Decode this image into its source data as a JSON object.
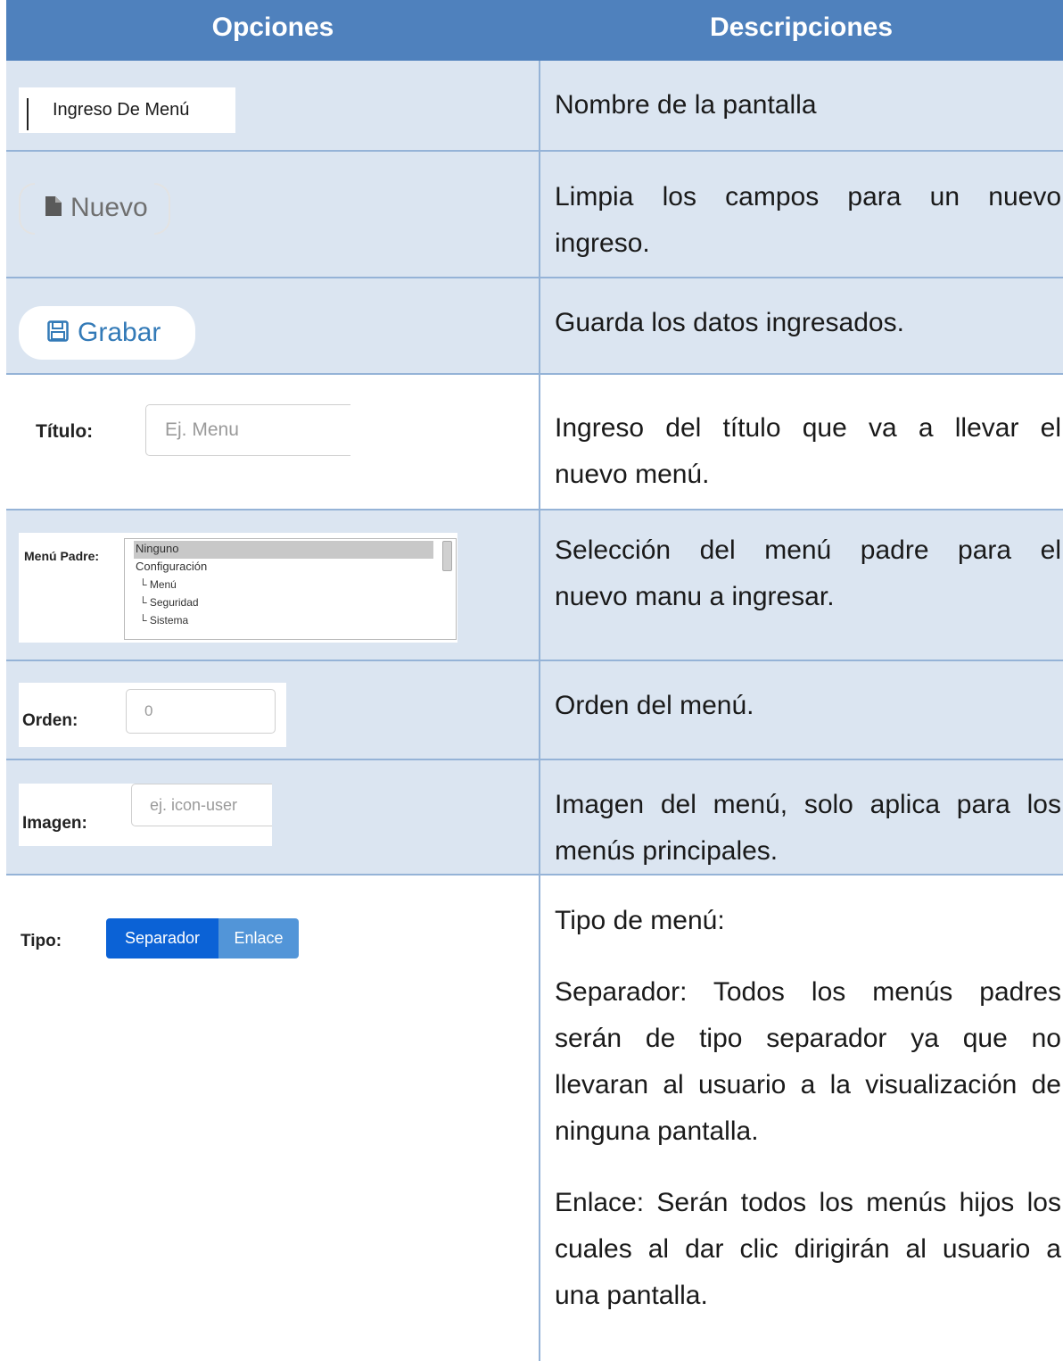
{
  "header": {
    "col_left": "Opciones",
    "col_right": "Descripciones"
  },
  "rows": [
    {
      "option_text": "Ingreso De Menú",
      "description": "Nombre de la pantalla"
    },
    {
      "option_text": "Nuevo",
      "icon": "file-icon",
      "description_lines": [
        "Limpia los campos para un nuevo",
        "ingreso."
      ]
    },
    {
      "option_text": "Grabar",
      "icon": "save-icon",
      "description": "Guarda los datos ingresados."
    },
    {
      "label": "Título:",
      "placeholder": "Ej. Menu",
      "description_lines": [
        "Ingreso del título que va a llevar el",
        "nuevo menú."
      ]
    },
    {
      "label": "Menú Padre:",
      "options": [
        "Ninguno",
        "Configuración",
        "└ Menú",
        "└ Seguridad",
        "└ Sistema"
      ],
      "selected": "Ninguno",
      "description_lines": [
        "Selección del menú padre para el",
        "nuevo manu a ingresar."
      ]
    },
    {
      "label": "Orden:",
      "placeholder": "0",
      "description": "Orden del menú."
    },
    {
      "label": "Imagen:",
      "placeholder": "ej. icon-user",
      "description_lines": [
        "Imagen del menú, solo aplica para los",
        "menús principales."
      ]
    },
    {
      "label": "Tipo:",
      "toggle": [
        "Separador",
        "Enlace"
      ],
      "active": "Separador",
      "description_title": "Tipo de menú:",
      "description_p1_lines": [
        "Separador: Todos los menús padres",
        "serán de tipo separador ya que no",
        "llevaran al usuario a la visualización de",
        "ninguna pantalla."
      ],
      "description_p2_lines": [
        "Enlace: Serán todos los menús hijos los",
        "cuales al dar clic dirigirán al usuario a",
        "una pantalla."
      ]
    }
  ],
  "colors": {
    "header_bg": "#4f81bd",
    "row_shade": "#dbe5f1",
    "border": "#95b3d7",
    "toggle_active": "#0b62d6",
    "toggle_inactive": "#5295d8"
  }
}
